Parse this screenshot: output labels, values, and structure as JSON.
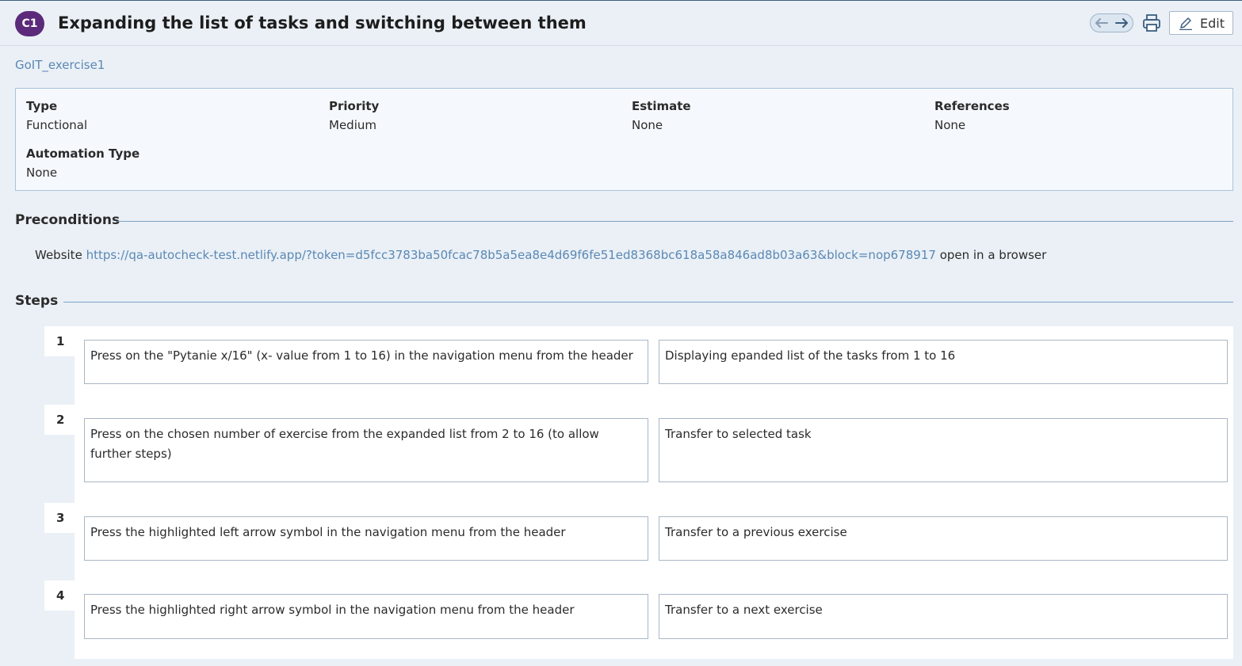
{
  "header": {
    "badge": "C1",
    "title": "Expanding the list of tasks and switching between them",
    "edit_label": "Edit"
  },
  "subtitle": "GoIT_exercise1",
  "props": [
    {
      "label": "Type",
      "value": "Functional"
    },
    {
      "label": "Priority",
      "value": "Medium"
    },
    {
      "label": "Estimate",
      "value": "None"
    },
    {
      "label": "References",
      "value": "None"
    },
    {
      "label": "Automation Type",
      "value": "None"
    }
  ],
  "preconditions": {
    "heading": "Preconditions",
    "prefix": "Website",
    "link": "https://qa-autocheck-test.netlify.app/?token=d5fcc3783ba50fcac78b5a5ea8e4d69f6fe51ed8368bc618a58a846ad8b03a63&block=nop678917",
    "suffix": "open in a browser"
  },
  "steps": {
    "heading": "Steps",
    "items": [
      {
        "num": "1",
        "action": "Press on the \"Pytanie x/16\" (x- value from 1 to 16) in the navigation menu from the header",
        "expected": "Displaying epanded list of the tasks from 1 to 16"
      },
      {
        "num": "2",
        "action": "Press on the chosen number of exercise from the expanded list from 2 to 16 (to allow further steps)",
        "expected": "Transfer to selected task"
      },
      {
        "num": "3",
        "action": "Press the highlighted left arrow symbol in the navigation menu from the header",
        "expected": "Transfer to a previous exercise"
      },
      {
        "num": "4",
        "action": "Press the highlighted right arrow symbol in the navigation menu from the header",
        "expected": "Transfer to a next exercise"
      }
    ]
  }
}
